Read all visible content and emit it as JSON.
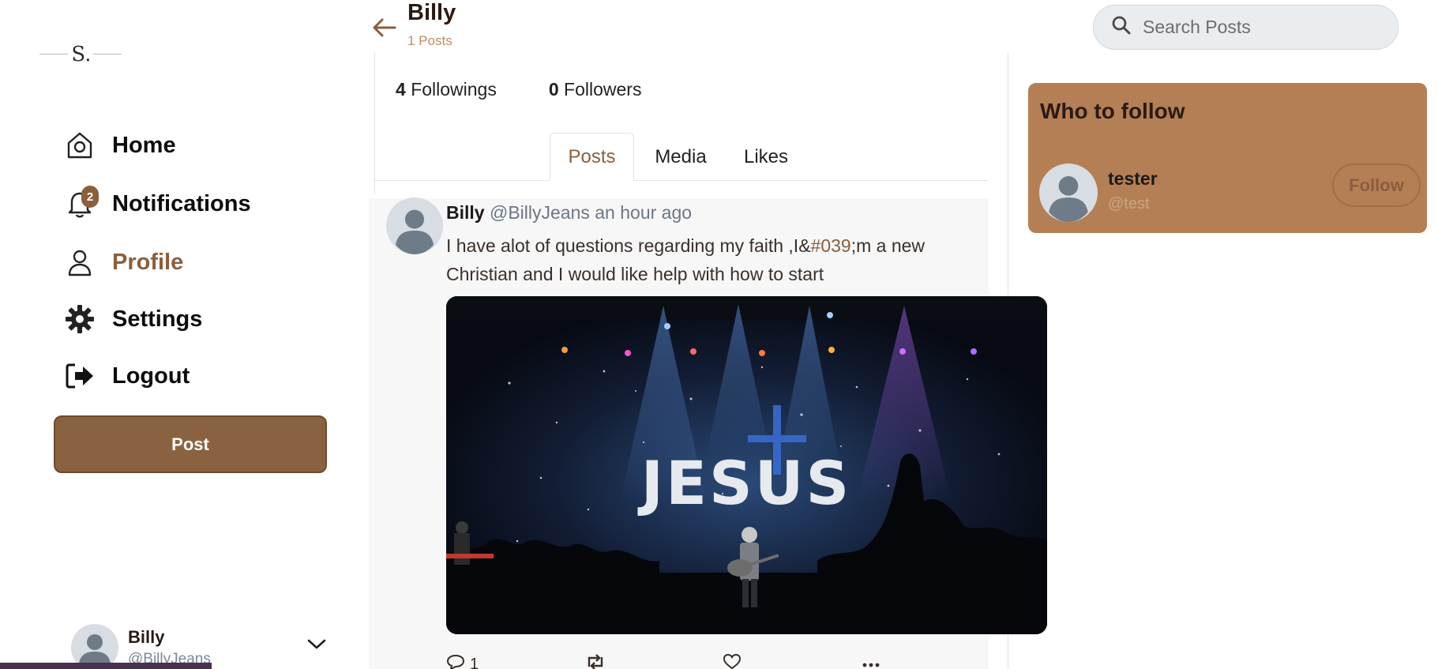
{
  "logo": {
    "mark": "S."
  },
  "nav": {
    "items": [
      {
        "label": "Home",
        "icon": "home-icon"
      },
      {
        "label": "Notifications",
        "icon": "bell-icon",
        "badge": "2"
      },
      {
        "label": "Profile",
        "icon": "user-icon",
        "active": true
      },
      {
        "label": "Settings",
        "icon": "gear-icon"
      },
      {
        "label": "Logout",
        "icon": "logout-icon"
      }
    ],
    "post_button": "Post"
  },
  "account": {
    "name": "Billy",
    "handle": "@BillyJeans"
  },
  "header": {
    "name": "Billy",
    "post_count": "1 Posts"
  },
  "stats": {
    "followings_count": "4",
    "followings_label": "Followings",
    "followers_count": "0",
    "followers_label": "Followers"
  },
  "tabs": {
    "posts": "Posts",
    "media": "Media",
    "likes": "Likes"
  },
  "post": {
    "author": "Billy",
    "handle": "@BillyJeans",
    "time": "an hour ago",
    "text_before": "I have alot of questions regarding my faith ,I&",
    "text_tag": "#039",
    "text_after": ";m a new Christian and I would like help with how to start",
    "image_text": "JESUS",
    "reply_count": "1"
  },
  "search": {
    "placeholder": "Search Posts"
  },
  "who_to_follow": {
    "title": "Who to follow",
    "user": {
      "name": "tester",
      "handle": "@test",
      "button": "Follow"
    }
  },
  "colors": {
    "accent": "#8b5e3c",
    "post_button": "#8b6240",
    "card": "#b47f54",
    "purple_bar": "#4a2f4f"
  }
}
